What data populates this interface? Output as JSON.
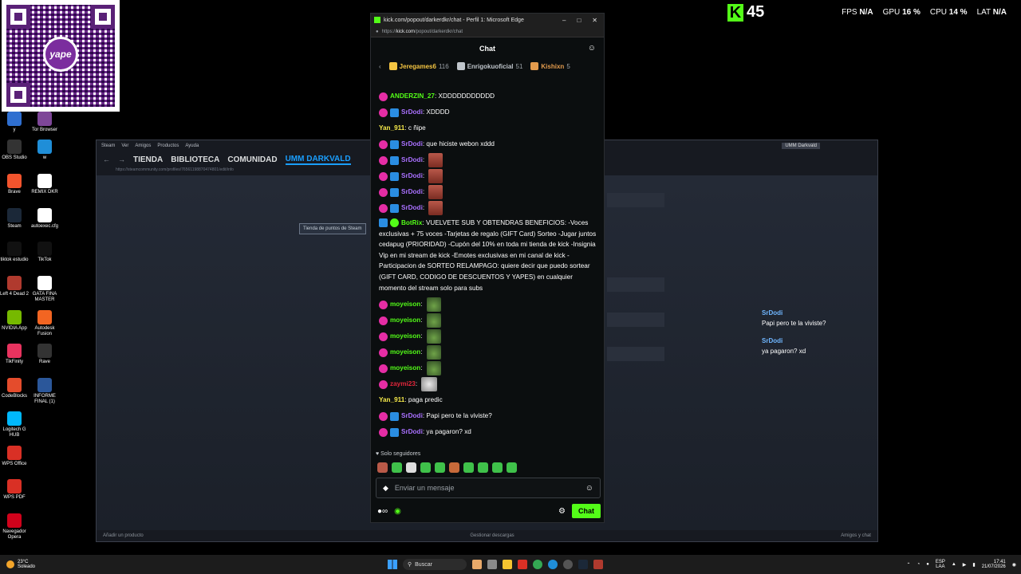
{
  "qr": {
    "logo_text": "yape"
  },
  "desktop_icons": [
    {
      "label": "y",
      "color": "#2f6fd0"
    },
    {
      "label": "Tor Browser",
      "color": "#7e4798"
    },
    {
      "label": "OBS Studio",
      "color": "#333333"
    },
    {
      "label": "w",
      "color": "#1f8ed8"
    },
    {
      "label": "Brave",
      "color": "#f2542d"
    },
    {
      "label": "REMIX DKR",
      "color": "#ffffff"
    },
    {
      "label": "Steam",
      "color": "#1b2838"
    },
    {
      "label": "autoexec.cfg",
      "color": "#ffffff"
    },
    {
      "label": "tiktok estudio",
      "color": "#111111"
    },
    {
      "label": "TikTok",
      "color": "#111111"
    },
    {
      "label": "Left 4 Dead 2",
      "color": "#b03a2e"
    },
    {
      "label": "GATA FINA MASTER",
      "color": "#ffffff"
    },
    {
      "label": "NVIDIA App",
      "color": "#76b900"
    },
    {
      "label": "Autodesk Fusion",
      "color": "#f26522"
    },
    {
      "label": "TikFinity",
      "color": "#e8335f"
    },
    {
      "label": "Rave",
      "color": "#333333"
    },
    {
      "label": "CodeBlocks",
      "color": "#e44c2c"
    },
    {
      "label": "INFORME FINAL (1)",
      "color": "#2b579a"
    },
    {
      "label": "Logitech G HUB",
      "color": "#00b8fc"
    },
    {
      "label": "WPS Office",
      "color": "#d93025"
    },
    {
      "label": "WPS PDF",
      "color": "#d93025"
    },
    {
      "label": "Navegador Opera",
      "color": "#d0021b"
    }
  ],
  "steam": {
    "menu": [
      "Steam",
      "Ver",
      "Amigos",
      "Productos",
      "Ayuda"
    ],
    "nav": [
      "TIENDA",
      "BIBLIOTECA",
      "COMUNIDAD",
      "UMM DARKVALD"
    ],
    "url": "https://steamcommunity.com/profiles/76561198870474801/edit/info",
    "points_button": "Tienda de puntos de Steam",
    "user": "UMM Darkvald",
    "footer_left": "Añadir un producto",
    "footer_center": "Gestionar descargas",
    "footer_right": "Amigos y chat"
  },
  "overlay": [
    {
      "user": "SrDodi",
      "text": "Papi pero te la viviste?"
    },
    {
      "user": "SrDodi",
      "text": "ya pagaron? xd"
    }
  ],
  "hud": {
    "kick_count": "45",
    "fps_label": "FPS",
    "fps": "N/A",
    "gpu_label": "GPU",
    "gpu": "16 %",
    "cpu_label": "CPU",
    "cpu": "14 %",
    "lat_label": "LAT",
    "lat": "N/A"
  },
  "edge": {
    "title": "kick.com/popout/darkerdkr/chat - Perfil 1: Microsoft Edge",
    "url_prefix": "https://",
    "url_domain": "kick.com",
    "url_path": "/popout/darkerdkr/chat"
  },
  "chat": {
    "header": "Chat",
    "gifters": [
      {
        "name": "Jeregames6",
        "count": "116",
        "color": "#f5c542"
      },
      {
        "name": "Enrigokuoficial",
        "count": "51",
        "color": "#c0c6cc"
      },
      {
        "name": "Kishixn",
        "count": "5",
        "color": "#e39b4d"
      }
    ],
    "messages": [
      {
        "user": "ANDERZIN_27",
        "color": "#53fc18",
        "text": "XDDDDDDDDDDD",
        "badges": [
          "sub"
        ],
        "emotes": []
      },
      {
        "user": "SrDodi",
        "color": "#a970ff",
        "text": "XDDDD",
        "badges": [
          "sub",
          "mod"
        ],
        "emotes": []
      },
      {
        "user": "Yan_911",
        "color": "#f5e94a",
        "text": "c ñipe",
        "badges": [],
        "emotes": []
      },
      {
        "user": "SrDodi",
        "color": "#a970ff",
        "text": "que hiciste webon xddd",
        "badges": [
          "sub",
          "mod"
        ],
        "emotes": []
      },
      {
        "user": "SrDodi",
        "color": "#a970ff",
        "text": "",
        "badges": [
          "sub",
          "mod"
        ],
        "emotes": [
          "face"
        ]
      },
      {
        "user": "SrDodi",
        "color": "#a970ff",
        "text": "",
        "badges": [
          "sub",
          "mod"
        ],
        "emotes": [
          "face"
        ]
      },
      {
        "user": "SrDodi",
        "color": "#a970ff",
        "text": "",
        "badges": [
          "sub",
          "mod"
        ],
        "emotes": [
          "face"
        ]
      },
      {
        "user": "SrDodi",
        "color": "#a970ff",
        "text": "",
        "badges": [
          "sub",
          "mod"
        ],
        "emotes": [
          "face"
        ]
      },
      {
        "user": "BotRix",
        "color": "#53fc18",
        "text": "VUELVETE SUB Y OBTENDRAS BENEFICIOS: -Voces exclusivas + 75 voces -Tarjetas de regalo (GIFT Card) Sorteo -Jugar juntos cedapug (PRIORIDAD) -Cupón del 10% en toda mi tienda de kick -Insignia Vip en mi stream de kick -Emotes exclusivas en mi canal de kick -Participacion de SORTEO RELAMPAGO: quiere decir que puedo sortear (GIFT CARD, CODIGO DE DESCUENTOS Y YAPES) en cualquier momento del stream solo para subs",
        "badges": [
          "mod",
          "ver"
        ],
        "emotes": [],
        "long": true
      },
      {
        "user": "moyeison",
        "color": "#53fc18",
        "text": "",
        "badges": [
          "sub"
        ],
        "emotes": [
          "frog"
        ]
      },
      {
        "user": "moyeison",
        "color": "#53fc18",
        "text": "",
        "badges": [
          "sub"
        ],
        "emotes": [
          "frog"
        ]
      },
      {
        "user": "moyeison",
        "color": "#53fc18",
        "text": "",
        "badges": [
          "sub"
        ],
        "emotes": [
          "frog"
        ]
      },
      {
        "user": "moyeison",
        "color": "#53fc18",
        "text": "",
        "badges": [
          "sub"
        ],
        "emotes": [
          "frog"
        ]
      },
      {
        "user": "moyeison",
        "color": "#53fc18",
        "text": "",
        "badges": [
          "sub"
        ],
        "emotes": [
          "frog"
        ]
      },
      {
        "user": "zaymi23",
        "color": "#e0263b",
        "text": "",
        "badges": [
          "sub"
        ],
        "emotes": [
          "cat"
        ]
      },
      {
        "user": "Yan_911",
        "color": "#f5e94a",
        "text": "paga predic",
        "badges": [],
        "emotes": []
      },
      {
        "user": "SrDodi",
        "color": "#a970ff",
        "text": "Papi pero te la viviste?",
        "badges": [
          "sub",
          "mod"
        ],
        "emotes": []
      },
      {
        "user": "SrDodi",
        "color": "#a970ff",
        "text": "ya pagaron? xd",
        "badges": [
          "sub",
          "mod"
        ],
        "emotes": []
      }
    ],
    "followers_label": "Solo seguidores",
    "input_placeholder": "Enviar un mensaje",
    "send_label": "Chat"
  },
  "taskbar": {
    "temp": "23°C",
    "weather": "Soleado",
    "search": "Buscar",
    "lang": "ESP",
    "region": "LAA",
    "time": "17:41",
    "date": "21/07/2026"
  },
  "colors": {
    "kick_green": "#53fc18",
    "steam_accent": "#1a9fff"
  }
}
